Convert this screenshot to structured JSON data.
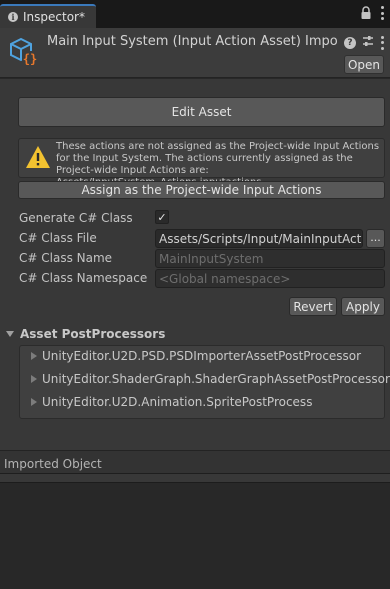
{
  "tab": {
    "label": "Inspector*"
  },
  "header": {
    "title": "Main Input System (Input Action Asset) Import Settings",
    "open_label": "Open"
  },
  "edit_asset_label": "Edit Asset",
  "warning": {
    "text": "These actions are not assigned as the Project-wide Input Actions for the Input System.  The actions currently assigned as the Project-wide Input Actions are: Assets/InputSystem_Actions.inputactions."
  },
  "assign_label": "Assign as the Project-wide Input Actions",
  "properties": {
    "generate_label": "Generate C# Class",
    "generate_checked": "✓",
    "class_file_label": "C# Class File",
    "class_file_value": "Assets/Scripts/Input/MainInputActions.cs",
    "browse_label": "...",
    "class_name_label": "C# Class Name",
    "class_name_placeholder": "MainInputSystem",
    "namespace_label": "C# Class Namespace",
    "namespace_placeholder": "<Global namespace>"
  },
  "revert_label": "Revert",
  "apply_label": "Apply",
  "postprocessors": {
    "title": "Asset PostProcessors",
    "items": [
      "UnityEditor.U2D.PSD.PSDImporterAssetPostProcessor",
      "UnityEditor.ShaderGraph.ShaderGraphAssetPostProcessor",
      "UnityEditor.U2D.Animation.SpritePostProcess"
    ]
  },
  "imported_object_label": "Imported Object",
  "colors": {
    "accent": "#3a79bb",
    "asset_icon_blue": "#4fa3e0",
    "asset_icon_orange": "#e8782c",
    "warning_yellow": "#f2c230"
  }
}
